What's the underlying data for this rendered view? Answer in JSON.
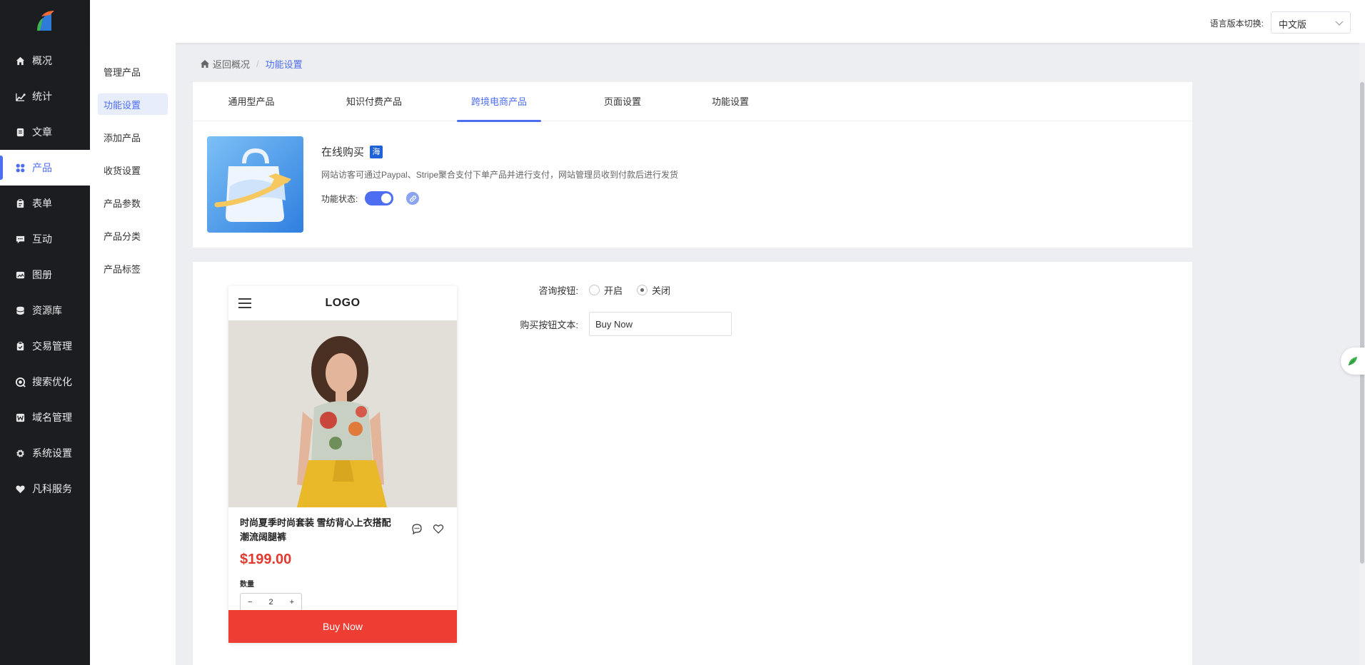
{
  "nav": {
    "items": [
      {
        "label": "概况",
        "icon": "home-icon"
      },
      {
        "label": "统计",
        "icon": "chart-icon"
      },
      {
        "label": "文章",
        "icon": "document-icon"
      },
      {
        "label": "产品",
        "icon": "grid-icon"
      },
      {
        "label": "表单",
        "icon": "clipboard-icon"
      },
      {
        "label": "互动",
        "icon": "chat-icon"
      },
      {
        "label": "图册",
        "icon": "album-icon"
      },
      {
        "label": "资源库",
        "icon": "database-icon"
      },
      {
        "label": "交易管理",
        "icon": "clipboard-check-icon"
      },
      {
        "label": "搜索优化",
        "icon": "seo-icon"
      },
      {
        "label": "域名管理",
        "icon": "w-icon"
      },
      {
        "label": "系统设置",
        "icon": "gear-icon"
      },
      {
        "label": "凡科服务",
        "icon": "heart-icon"
      }
    ],
    "active_index": 3
  },
  "header": {
    "lang_label": "语言版本切换:",
    "lang_value": "中文版"
  },
  "submenu": {
    "items": [
      "管理产品",
      "功能设置",
      "添加产品",
      "收货设置",
      "产品参数",
      "产品分类",
      "产品标签"
    ],
    "active_index": 1
  },
  "breadcrumb": {
    "back": "返回概况",
    "separator": "/",
    "current": "功能设置"
  },
  "tabs": {
    "items": [
      "通用型产品",
      "知识付费产品",
      "跨境电商产品",
      "页面设置",
      "功能设置"
    ],
    "active_index": 2
  },
  "feature": {
    "title": "在线购买",
    "badge": "海",
    "description": "网站访客可通过Paypal、Stripe聚合支付下单产品并进行支付，网站管理员收到付款后进行发货",
    "status_label": "功能状态:",
    "status_on": true
  },
  "preview": {
    "logo": "LOGO",
    "product_title": "时尚夏季时尚套装 雪纺背心上衣搭配潮流阔腿裤",
    "price": "$199.00",
    "qty_label": "数量",
    "qty_minus": "−",
    "qty_value": "2",
    "qty_plus": "+",
    "buy_label": "Buy Now"
  },
  "form": {
    "consult_label": "咨询按钮:",
    "consult_options": [
      "开启",
      "关闭"
    ],
    "consult_selected": "关闭",
    "buy_text_label": "购买按钮文本:",
    "buy_text_value": "Buy Now"
  },
  "colors": {
    "accent": "#4e6ef2",
    "sidebar_bg": "#1c1d21",
    "buy_button": "#ee3d32",
    "price": "#e33a2f"
  }
}
